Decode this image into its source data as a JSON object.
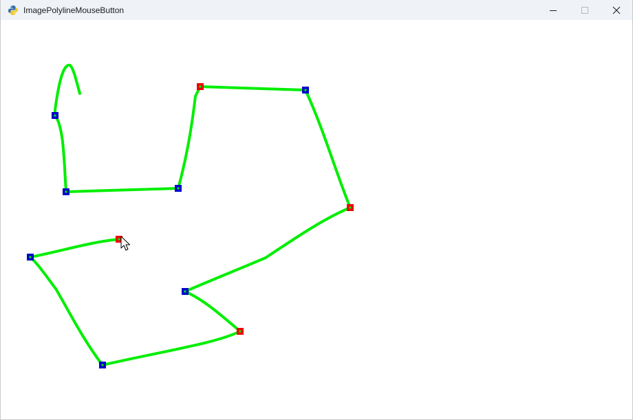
{
  "window": {
    "title": "ImagePolylineMouseButton",
    "app_icon": "python-logo-icon",
    "controls": {
      "minimize_icon": "minimize-icon",
      "maximize_icon": "maximize-icon",
      "close_icon": "close-icon"
    }
  },
  "canvas": {
    "background": "#ffffff",
    "polyline_color": "#00ee00",
    "marker_colors": {
      "left_click": "#0000cc",
      "right_click": "#ee0000"
    },
    "cursor_icon": "mouse-pointer-icon"
  }
}
